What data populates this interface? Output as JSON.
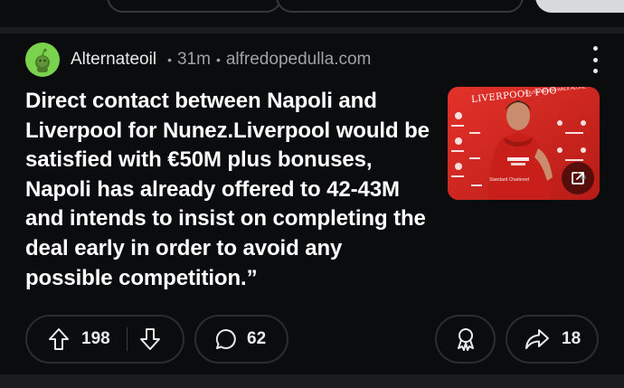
{
  "post": {
    "author": "Alternateoil",
    "age": "31m",
    "domain": "alfredopedulla.com",
    "title": "Direct contact between Napoli and Liverpool for Nunez.Liverpool would be satisfied with €50M plus bonuses, Napoli has already offered to 42-43M and intends to insist on completing the deal early in order to avoid any possible competition.”",
    "thumbnail": {
      "banner_text": "LIVERPOOL FOO",
      "banner_sub": "YOU'LL NEVER WALK ALONE",
      "sponsor_text": "Standard Chartered",
      "link_icon": "external-link-icon"
    }
  },
  "actions": {
    "upvotes": "198",
    "comments": "62",
    "shares": "18",
    "upvote_icon": "arrow-up-icon",
    "downvote_icon": "arrow-down-icon",
    "comment_icon": "comment-bubble-icon",
    "award_icon": "award-icon",
    "share_icon": "share-arrow-icon"
  },
  "colors": {
    "background": "#0b0c0e",
    "avatar": "#7ad34c",
    "thumbnail_red": "#d8261f",
    "text_muted": "#9ea3a8"
  }
}
